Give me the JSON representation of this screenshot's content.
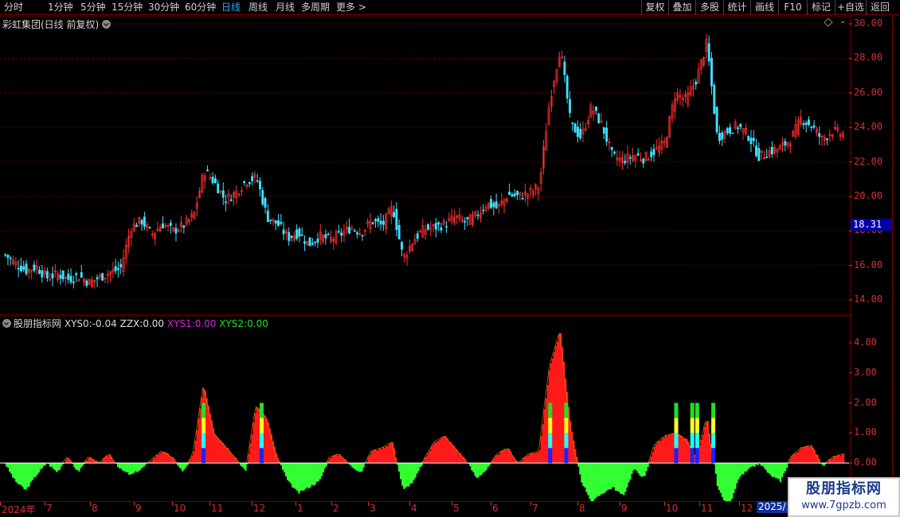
{
  "toolbar": {
    "periods": [
      "分时",
      "1分钟",
      "5分钟",
      "15分钟",
      "30分钟",
      "60分钟",
      "日线",
      "周线",
      "月线",
      "多周期",
      "更多 >"
    ],
    "active_period": "日线",
    "right_buttons": [
      "复权",
      "叠加",
      "多股",
      "统计",
      "画线",
      "F10",
      "标记",
      "+自选",
      "返回"
    ]
  },
  "main_chart": {
    "title": "彩虹集团(日线 前复权)",
    "price_marker": "18.31",
    "y_ticks": [
      "30.00",
      "28.00",
      "26.00",
      "24.00",
      "22.00",
      "20.00",
      "18.00",
      "16.00",
      "14.00"
    ]
  },
  "indicator": {
    "name": "股朋指标网",
    "xys0_label": "XYS0:",
    "xys0_value": "-0.04",
    "zzx_label": "ZZX:",
    "zzx_value": "0.00",
    "xys1_label": "XYS1:",
    "xys1_value": "0.00",
    "xys2_label": "XYS2:",
    "xys2_value": "0.00",
    "y_ticks": [
      "4.00",
      "3.00",
      "2.00",
      "1.00",
      "0.00"
    ]
  },
  "date_axis": {
    "labels": [
      "2024年",
      "7",
      "8",
      "9",
      "10",
      "11",
      "12",
      "1",
      "2",
      "3",
      "4",
      "5",
      "6",
      "7",
      "8",
      "9",
      "10",
      "11",
      "12"
    ],
    "highlight": "2025/"
  },
  "watermark": {
    "title": "股朋指标网",
    "url": "www.7gpzb.com"
  },
  "colors": {
    "up": "#ff3030",
    "down": "#40e0ff",
    "positive_area": "#ff1a1a",
    "negative_area": "#33ff33",
    "axis": "#d43030",
    "grid": "#7a0000"
  },
  "chart_data": {
    "type": "candlestick",
    "price_ylim": [
      14.0,
      30.0
    ],
    "price_close_series": [
      16.6,
      16.1,
      15.7,
      15.9,
      15.3,
      15.5,
      15.2,
      15.4,
      15.0,
      15.3,
      15.6,
      15.8,
      18.2,
      18.6,
      17.8,
      18.4,
      18.0,
      18.3,
      18.9,
      21.5,
      20.8,
      19.8,
      20.2,
      20.9,
      21.1,
      18.8,
      18.4,
      17.6,
      17.9,
      17.2,
      17.7,
      17.5,
      17.8,
      18.2,
      17.9,
      18.6,
      18.3,
      19.4,
      16.4,
      17.5,
      18.1,
      18.2,
      18.4,
      18.8,
      18.5,
      18.9,
      19.6,
      19.3,
      20.1,
      20.0,
      20.2,
      20.6,
      25.6,
      28.6,
      24.2,
      23.4,
      25.2,
      24.1,
      22.3,
      22.1,
      22.4,
      22.2,
      22.6,
      23.1,
      26.0,
      25.6,
      26.8,
      28.9,
      23.4,
      23.8,
      24.1,
      23.5,
      22.3,
      22.6,
      22.8,
      23.3,
      24.5,
      24.1,
      23.3,
      23.8,
      23.6
    ],
    "indicator_ylim": [
      -1.0,
      4.5
    ],
    "indicator_series": [
      0.0,
      -0.6,
      -0.9,
      -0.4,
      0.0,
      -0.3,
      0.2,
      -0.3,
      0.2,
      0.0,
      0.3,
      -0.2,
      -0.4,
      -0.2,
      0.1,
      0.4,
      0.2,
      -0.3,
      0.3,
      2.6,
      1.0,
      0.6,
      0.2,
      -0.3,
      1.9,
      1.5,
      0.2,
      -0.6,
      -1.0,
      -0.8,
      -0.6,
      0.2,
      0.3,
      -0.1,
      -0.3,
      0.4,
      0.5,
      0.7,
      -0.9,
      -0.6,
      0.1,
      0.7,
      0.9,
      0.5,
      0.1,
      -0.5,
      -0.2,
      0.3,
      0.5,
      0.0,
      0.3,
      0.4,
      3.2,
      4.4,
      1.2,
      -0.6,
      -1.3,
      -1.0,
      -0.8,
      -1.1,
      -0.2,
      -0.5,
      0.6,
      0.9,
      1.0,
      0.8,
      0.2,
      1.5,
      -0.8,
      -1.6,
      -0.5,
      -0.2,
      0.0,
      -0.4,
      -0.6,
      0.2,
      0.5,
      0.6,
      -0.1,
      0.2,
      0.3
    ],
    "signal_bars_x_index": [
      19,
      24,
      52,
      53,
      64,
      65,
      66,
      67
    ]
  }
}
